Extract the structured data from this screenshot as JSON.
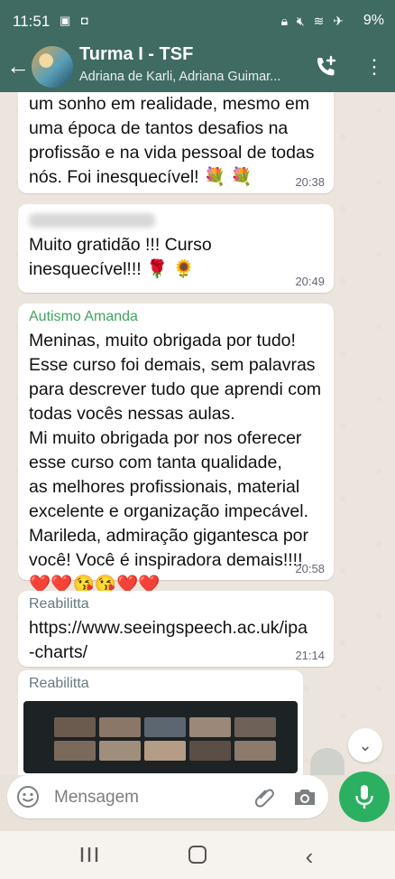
{
  "status_bar": {
    "time": "11:51",
    "battery": "9%"
  },
  "header": {
    "title": "Turma I - TSF",
    "subtitle": "Adriana de Karli, Adriana Guimar..."
  },
  "messages": [
    {
      "text": "um sonho em realidade, mesmo  em\numa época de tantos desafios na\nprofissão e na vida pessoal de  todas\nnós. Foi inesquecível! 💐 💐",
      "time": "20:38"
    },
    {
      "text": "Muito gratidão !!! Curso\ninesquecível!!!  🌹 🌻",
      "time": "20:49"
    },
    {
      "sender": "Autismo Amanda",
      "sender_color": "#3fa35e",
      "text": "Meninas, muito obrigada por tudo!\nEsse curso foi demais, sem palavras\npara descrever tudo que aprendi com\ntodas vocês nessas aulas.\nMi muito obrigada por nos oferecer\nesse curso com tanta qualidade,\nas melhores profissionais, material\nexcelente e organização impecável.\nMarileda, admiração gigantesca por\nvocê! Você é inspiradora demais!!!!\n❤️❤️😘😘❤️❤️",
      "time": "20:58"
    },
    {
      "sender": "Reabilitta",
      "sender_color": "#667781",
      "link": "https://www.seeingspeech.ac.uk/ipa\n-charts/",
      "time": "21:14"
    },
    {
      "sender": "Reabilitta",
      "sender_color": "#667781"
    }
  ],
  "composer": {
    "placeholder": "Mensagem"
  },
  "colors": {
    "header": "#3f6b63",
    "mic": "#2bb061",
    "link": "#1c6fa8"
  }
}
